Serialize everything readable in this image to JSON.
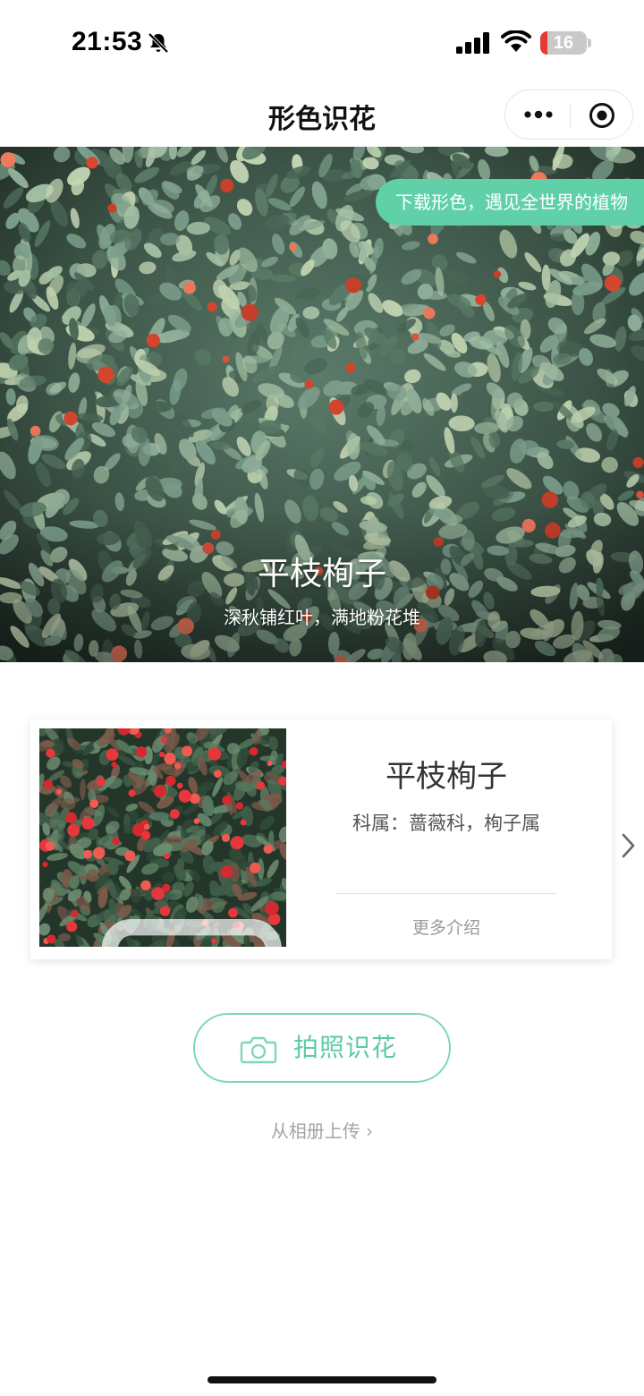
{
  "status_bar": {
    "time": "21:53",
    "battery_level": "16",
    "battery_fill_fraction": 0.16,
    "icons": [
      "bell-muted-icon",
      "cell-signal-icon",
      "wifi-icon",
      "battery-icon"
    ]
  },
  "nav": {
    "title": "形色识花",
    "capsule_icons": [
      "more-dots-icon",
      "close-target-icon"
    ]
  },
  "hero": {
    "banner": "下载形色，遇见全世界的植物",
    "plant_name": "平枝栒子",
    "tagline": "深秋铺红叶，满地粉花堆"
  },
  "result_card": {
    "name": "平枝栒子",
    "family": "科属：蔷薇科，栒子属",
    "more_label": "更多介绍"
  },
  "actions": {
    "photo_button": "拍照识花",
    "upload_link": "从相册上传 ›"
  },
  "colors": {
    "accent": "#5fd0a8",
    "accent_text": "#5ccaa5",
    "battery_low": "#e53935"
  }
}
